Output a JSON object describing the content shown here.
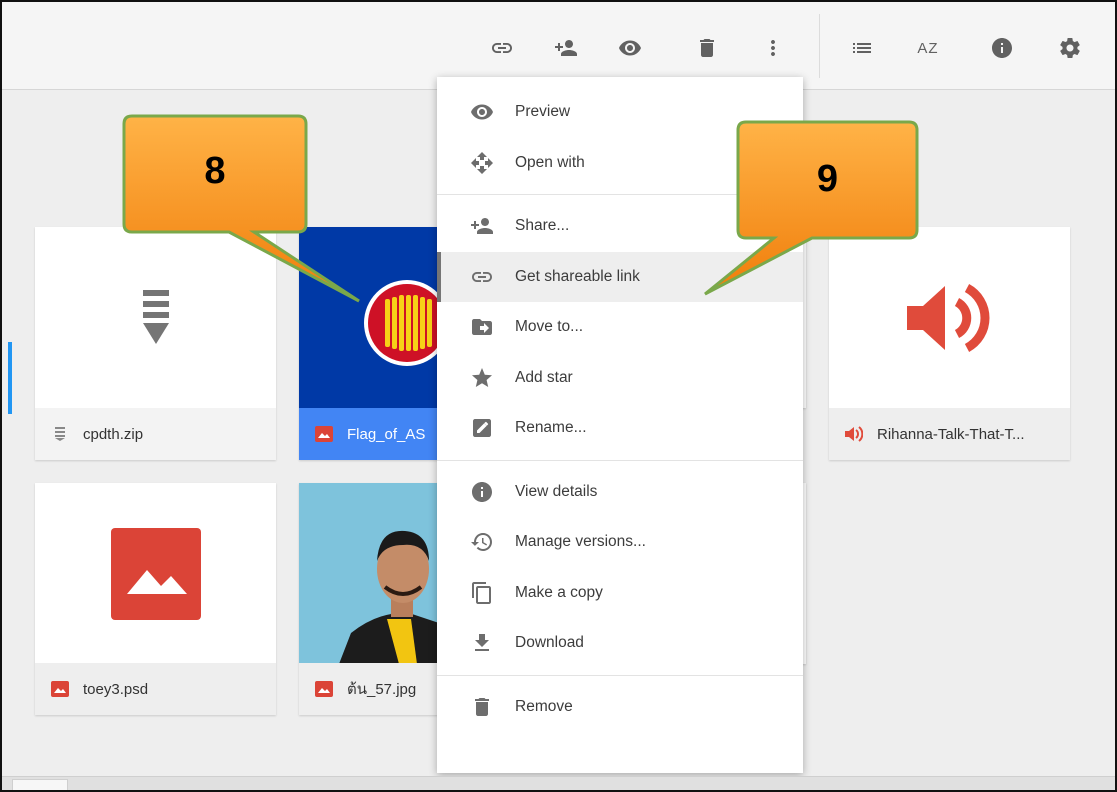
{
  "toolbar": {
    "icons": [
      "link-icon",
      "add-person-icon",
      "eye-icon",
      "trash-icon",
      "more-vert-icon",
      "list-view-icon",
      "sort-az-icon",
      "info-icon",
      "settings-icon"
    ],
    "sort_glyph": "AZ"
  },
  "files": [
    {
      "name": "cpdth.zip",
      "type": "zip",
      "selected": false
    },
    {
      "name": "Flag_of_AS",
      "type": "image",
      "selected": true
    },
    {
      "name": "Rihanna-Talk-That-T...",
      "type": "audio",
      "selected": false
    },
    {
      "name": "toey3.psd",
      "type": "image",
      "selected": false
    },
    {
      "name": "ต้น_57.jpg",
      "type": "image",
      "selected": false
    }
  ],
  "context_menu": {
    "groups": [
      [
        {
          "label": "Preview",
          "icon": "eye-icon"
        },
        {
          "label": "Open with",
          "icon": "move-arrows-icon"
        }
      ],
      [
        {
          "label": "Share...",
          "icon": "add-person-icon"
        },
        {
          "label": "Get shareable link",
          "icon": "link-icon",
          "highlighted": true
        },
        {
          "label": "Move to...",
          "icon": "move-folder-icon"
        },
        {
          "label": "Add star",
          "icon": "star-icon"
        },
        {
          "label": "Rename...",
          "icon": "rename-icon"
        }
      ],
      [
        {
          "label": "View details",
          "icon": "info-icon"
        },
        {
          "label": "Manage versions...",
          "icon": "history-icon"
        },
        {
          "label": "Make a copy",
          "icon": "copy-icon"
        },
        {
          "label": "Download",
          "icon": "download-icon"
        }
      ],
      [
        {
          "label": "Remove",
          "icon": "trash-icon"
        }
      ]
    ]
  },
  "callouts": [
    {
      "number": "8"
    },
    {
      "number": "9"
    }
  ],
  "colors": {
    "callout_fill": "#f7931e",
    "callout_border": "#7aa84a",
    "selection": "#4285f4",
    "audio": "#e04b3b",
    "image_icon": "#db4437",
    "flag_blue": "#0039a6"
  }
}
